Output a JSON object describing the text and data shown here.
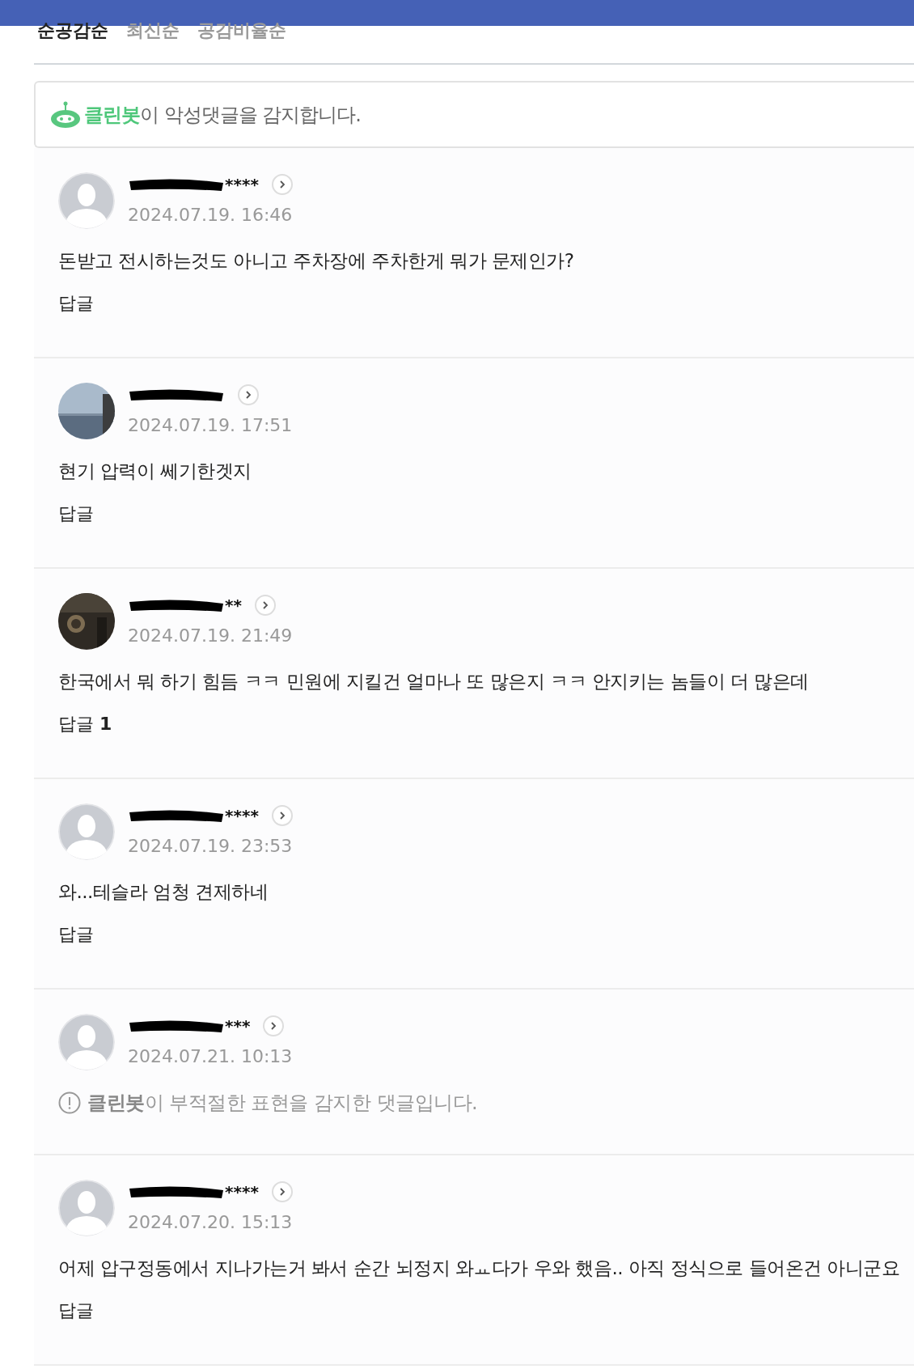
{
  "sort_tabs": [
    {
      "label": "순공감순",
      "selected": true
    },
    {
      "label": "최신순",
      "selected": false
    },
    {
      "label": "공감비율순",
      "selected": false
    }
  ],
  "cleanbot_notice": "**클린봇**이 악성댓글을 감지합니다.",
  "comments": [
    {
      "kind": "normal",
      "avatar": {
        "kind": "default"
      },
      "username_tail": "****",
      "date": "2024.07.19. 16:46",
      "text": "돈받고 전시하는것도 아니고 주차장에 주차한게 뭐가 문제인가?",
      "reply_label": "답글"
    },
    {
      "kind": "normal",
      "date": "2024.07.19. 17:51",
      "text": "현기 압력이 쎄기한겟지",
      "reply_label": "답글"
    },
    {
      "kind": "normal",
      "username_tail": "**",
      "date": "2024.07.19. 21:49",
      "text": "한국에서 뭐 하기 힘듬 ㅋㅋ 민원에 지킬건 얼마나 또 많은지 ㅋㅋ 안지키는 놈들이 더 많은데",
      "reply_label": "답글",
      "reply_count": "1"
    },
    {
      "kind": "normal",
      "avatar": {
        "kind": "default"
      },
      "username_tail": "****",
      "date": "2024.07.19. 23:53",
      "text": "와...테슬라 엄청 견제하네",
      "reply_label": "답글"
    },
    {
      "kind": "flagged",
      "avatar": {
        "kind": "default"
      },
      "username_tail": "***",
      "date": "2024.07.21. 10:13",
      "text": "**클린봇**이 부적절한 표현을 감지한 댓글입니다."
    },
    {
      "kind": "normal",
      "avatar": {
        "kind": "default"
      },
      "username_tail": "****",
      "date": "2024.07.20. 15:13",
      "text": "어제 압구정동에서 지나가는거 봐서 순간 뇌정지 와ㅛ다가 우와 했음.. 아직 정식으로 들어온건 아니군요",
      "reply_label": "답글"
    }
  ]
}
